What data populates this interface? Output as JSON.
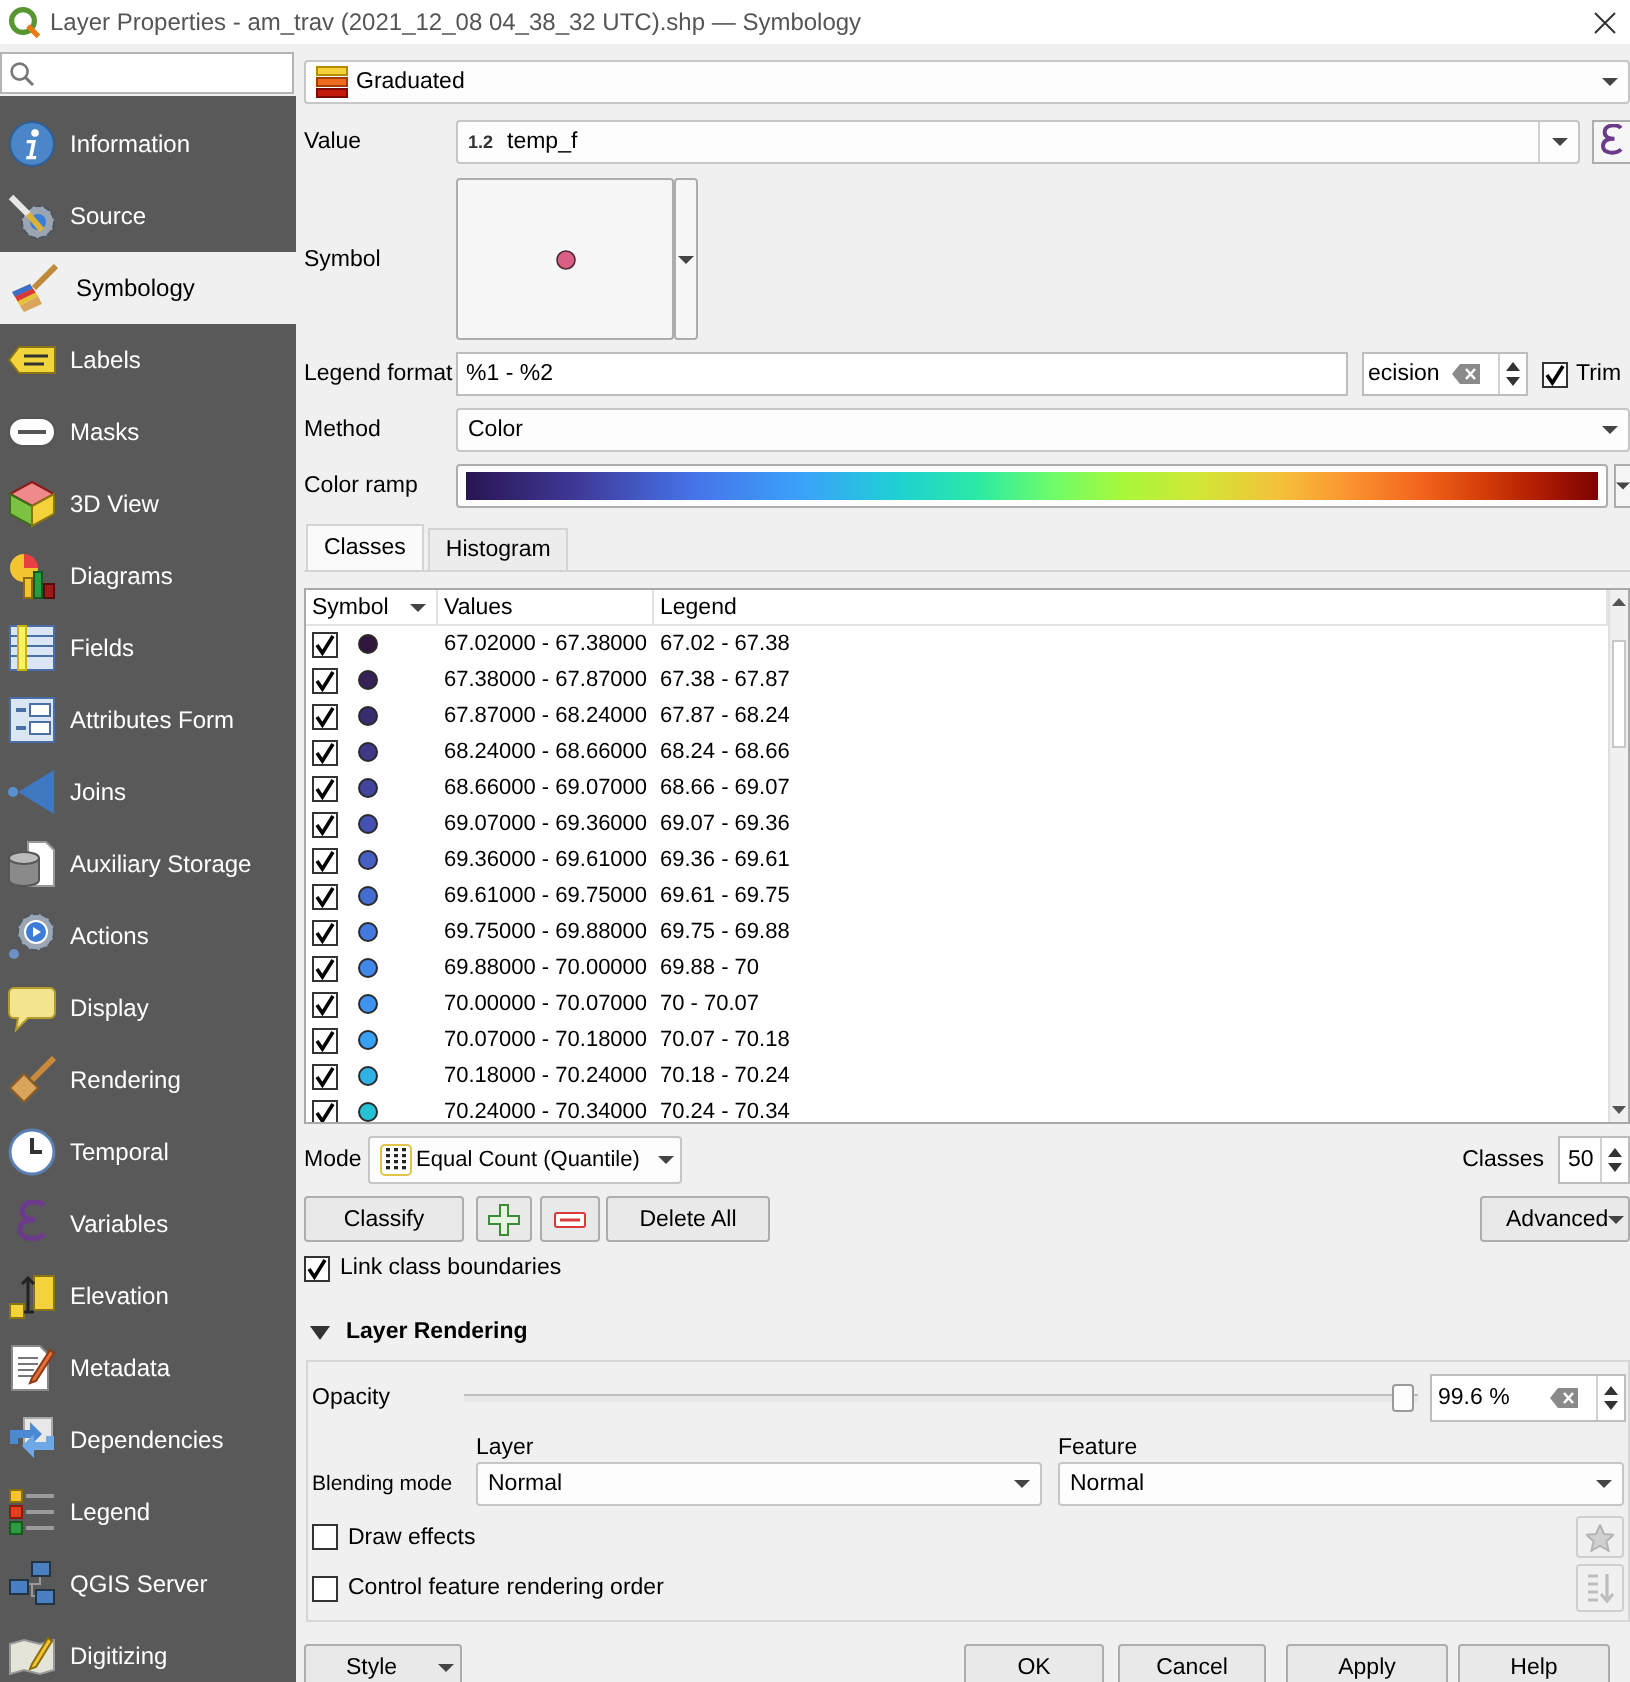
{
  "window": {
    "title": "Layer Properties - am_trav (2021_12_08 04_38_32 UTC).shp — Symbology"
  },
  "sidebar": {
    "items": [
      {
        "label": "Information",
        "selected": false
      },
      {
        "label": "Source",
        "selected": false
      },
      {
        "label": "Symbology",
        "selected": true
      },
      {
        "label": "Labels",
        "selected": false
      },
      {
        "label": "Masks",
        "selected": false
      },
      {
        "label": "3D View",
        "selected": false
      },
      {
        "label": "Diagrams",
        "selected": false
      },
      {
        "label": "Fields",
        "selected": false
      },
      {
        "label": "Attributes Form",
        "selected": false
      },
      {
        "label": "Joins",
        "selected": false
      },
      {
        "label": "Auxiliary Storage",
        "selected": false
      },
      {
        "label": "Actions",
        "selected": false
      },
      {
        "label": "Display",
        "selected": false
      },
      {
        "label": "Rendering",
        "selected": false
      },
      {
        "label": "Temporal",
        "selected": false
      },
      {
        "label": "Variables",
        "selected": false
      },
      {
        "label": "Elevation",
        "selected": false
      },
      {
        "label": "Metadata",
        "selected": false
      },
      {
        "label": "Dependencies",
        "selected": false
      },
      {
        "label": "Legend",
        "selected": false
      },
      {
        "label": "QGIS Server",
        "selected": false
      },
      {
        "label": "Digitizing",
        "selected": false
      }
    ]
  },
  "renderer": {
    "value": "Graduated"
  },
  "value_field": {
    "label": "Value",
    "type_indicator": "1.2",
    "value": "temp_f"
  },
  "symbol": {
    "label": "Symbol"
  },
  "legend_format": {
    "label": "Legend format",
    "value": "%1 - %2",
    "precision": "ecision",
    "trim": {
      "label": "Trim",
      "checked": true
    }
  },
  "method": {
    "label": "Method",
    "value": "Color"
  },
  "color_ramp": {
    "label": "Color ramp"
  },
  "tabs": [
    {
      "label": "Classes",
      "selected": true
    },
    {
      "label": "Histogram",
      "selected": false
    }
  ],
  "classes_table": {
    "columns": [
      "Symbol",
      "Values",
      "Legend"
    ],
    "rows": [
      {
        "checked": true,
        "color": "#30153d",
        "values": "67.02000 - 67.38000",
        "legend": "67.02 - 67.38"
      },
      {
        "checked": true,
        "color": "#362157",
        "values": "67.38000 - 67.87000",
        "legend": "67.38 - 67.87"
      },
      {
        "checked": true,
        "color": "#3b2c70",
        "values": "67.87000 - 68.24000",
        "legend": "67.87 - 68.24"
      },
      {
        "checked": true,
        "color": "#3f3887",
        "values": "68.24000 - 68.66000",
        "legend": "68.24 - 68.66"
      },
      {
        "checked": true,
        "color": "#42459d",
        "values": "68.66000 - 69.07000",
        "legend": "68.66 - 69.07"
      },
      {
        "checked": true,
        "color": "#4452b1",
        "values": "69.07000 - 69.36000",
        "legend": "69.07 - 69.36"
      },
      {
        "checked": true,
        "color": "#455fc2",
        "values": "69.36000 - 69.61000",
        "legend": "69.36 - 69.61"
      },
      {
        "checked": true,
        "color": "#456cd1",
        "values": "69.61000 - 69.75000",
        "legend": "69.61 - 69.75"
      },
      {
        "checked": true,
        "color": "#4479de",
        "values": "69.75000 - 69.88000",
        "legend": "69.75 - 69.88"
      },
      {
        "checked": true,
        "color": "#4286e9",
        "values": "69.88000 - 70.00000",
        "legend": "69.88 - 70"
      },
      {
        "checked": true,
        "color": "#3e93f1",
        "values": "70.00000 - 70.07000",
        "legend": "70 - 70.07"
      },
      {
        "checked": true,
        "color": "#38a1f5",
        "values": "70.07000 - 70.18000",
        "legend": "70.07 - 70.18"
      },
      {
        "checked": true,
        "color": "#2fb1e6",
        "values": "70.18000 - 70.24000",
        "legend": "70.18 - 70.24"
      },
      {
        "checked": true,
        "color": "#27c1d6",
        "values": "70.24000 - 70.34000",
        "legend": "70.24 - 70.34"
      }
    ]
  },
  "mode": {
    "label": "Mode",
    "value": "Equal Count (Quantile)"
  },
  "classes_count": {
    "label": "Classes",
    "value": "50"
  },
  "actions": {
    "classify": "Classify",
    "delete_all": "Delete All",
    "advanced": "Advanced"
  },
  "link_class_boundaries": {
    "label": "Link class boundaries",
    "checked": true
  },
  "layer_rendering": {
    "title": "Layer Rendering",
    "expanded": true,
    "opacity": {
      "label": "Opacity",
      "level": 0.996,
      "value": "99.6 %"
    },
    "blending": {
      "label": "Blending mode",
      "layer": {
        "label": "Layer",
        "value": "Normal"
      },
      "feature": {
        "label": "Feature",
        "value": "Normal"
      }
    },
    "options": [
      {
        "label": "Draw effects",
        "checked": false
      },
      {
        "label": "Control feature rendering order",
        "checked": false
      }
    ]
  },
  "footer": {
    "style": "Style",
    "buttons": [
      "OK",
      "Cancel",
      "Apply",
      "Help"
    ]
  }
}
